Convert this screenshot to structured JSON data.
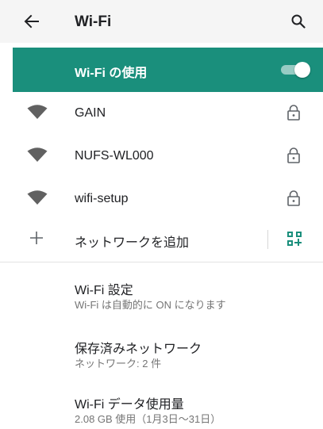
{
  "app_bar": {
    "title": "Wi-Fi",
    "back_icon": "arrow-left-icon",
    "search_icon": "search-icon"
  },
  "master_switch": {
    "label": "Wi-Fi の使用",
    "enabled": true,
    "accent_color": "#1a8f7c"
  },
  "networks": [
    {
      "ssid": "GAIN",
      "secured": true
    },
    {
      "ssid": "NUFS-WL000",
      "secured": true
    },
    {
      "ssid": "wifi-setup",
      "secured": true
    }
  ],
  "add_network": {
    "label": "ネットワークを追加",
    "plus_icon": "plus-icon",
    "qr_icon": "qr-code-icon",
    "qr_color": "#1a8f7c"
  },
  "preferences": [
    {
      "title": "Wi-Fi 設定",
      "subtitle": "Wi-Fi は自動的に ON になります"
    },
    {
      "title": "保存済みネットワーク",
      "subtitle": "ネットワーク: 2 件"
    },
    {
      "title": "Wi-Fi データ使用量",
      "subtitle": "2.08 GB 使用（1月3日〜31日）"
    }
  ]
}
